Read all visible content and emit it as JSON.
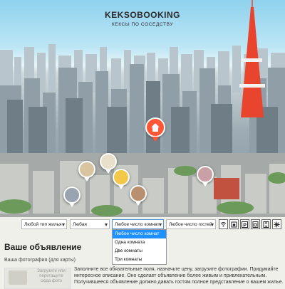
{
  "logo": {
    "title": "KEKSOBOOKING",
    "subtitle": "КЕКСЫ ПО СОСЕДСТВУ"
  },
  "map": {
    "pins": [
      {
        "name": "avatar-pin-1",
        "color": "#d9c4a0"
      },
      {
        "name": "avatar-pin-2",
        "color": "#e8e0c8"
      },
      {
        "name": "avatar-pin-3",
        "color": "#f3c84a"
      },
      {
        "name": "avatar-pin-4",
        "color": "#caa0a8"
      },
      {
        "name": "avatar-pin-5",
        "color": "#b89070"
      },
      {
        "name": "avatar-pin-6",
        "color": "#9aa4b0"
      }
    ],
    "main_pin_color": "#ff5635"
  },
  "filters": {
    "housing_type": "Любой тип жилья",
    "price": "Любая",
    "rooms": "Любое число комнат",
    "guests": "Любое число гостей",
    "features": [
      "wifi-icon",
      "dishwasher-icon",
      "parking-icon",
      "washer-icon",
      "elevator-icon",
      "conditioner-icon"
    ]
  },
  "rooms_dropdown": {
    "options": [
      "Любое число комнат",
      "Одна комната",
      "Две комнаты",
      "Три комнаты"
    ],
    "selected_index": 0
  },
  "form": {
    "heading": "Ваше объявление",
    "photo_label": "Ваша фотография (для карты)",
    "upload_hint": "Загрузите или перетащите сюда фото",
    "instructions": "Заполните все обязательные поля, назначьте цену, загрузите фотографии. Придумайте интересное описание. Оно сделает объявление более живым и привлекательным. Получившееся объявление должно давать гостям полное представление о вашем жилье."
  },
  "colors": {
    "accent": "#ff5635",
    "dropdown_highlight": "#1e90ff"
  }
}
